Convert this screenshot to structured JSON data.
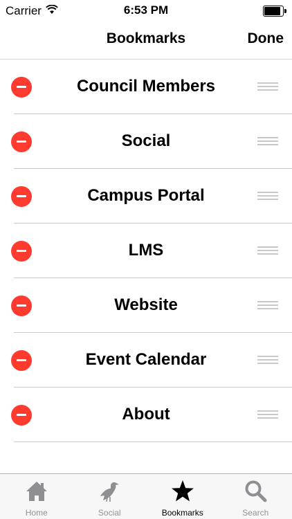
{
  "status_bar": {
    "carrier": "Carrier",
    "time": "6:53 PM",
    "battery_level": 0.9
  },
  "nav": {
    "title": "Bookmarks",
    "done_label": "Done"
  },
  "bookmarks": [
    {
      "label": "Council Members"
    },
    {
      "label": "Social"
    },
    {
      "label": "Campus Portal"
    },
    {
      "label": "LMS"
    },
    {
      "label": "Website"
    },
    {
      "label": "Event Calendar"
    },
    {
      "label": "About"
    }
  ],
  "tabs": [
    {
      "label": "Home",
      "icon": "home-icon",
      "active": false
    },
    {
      "label": "Social",
      "icon": "bird-icon",
      "active": false
    },
    {
      "label": "Bookmarks",
      "icon": "star-icon",
      "active": true
    },
    {
      "label": "Search",
      "icon": "search-icon",
      "active": false
    }
  ],
  "colors": {
    "delete": "#ff3b30",
    "tab_inactive": "#929292",
    "tab_active": "#000000"
  }
}
